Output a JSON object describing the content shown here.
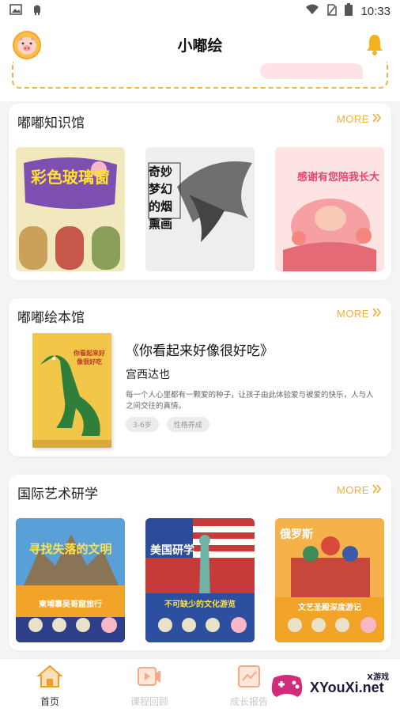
{
  "status_bar": {
    "time": "10:33",
    "icons": [
      "image-icon",
      "android-icon",
      "wifi-icon",
      "no-sim-icon",
      "battery-icon"
    ]
  },
  "header": {
    "title": "小嘟绘",
    "avatar": "pig-avatar-icon",
    "right_icon": "bell-icon"
  },
  "sections": {
    "knowledge": {
      "title": "嘟嘟知识馆",
      "more": "MORE",
      "items": [
        {
          "cover_text": "彩色玻璃窗",
          "accent": "#6a3fa0"
        },
        {
          "cover_text": "奇妙梦幻的烟熏画",
          "accent": "#333333"
        },
        {
          "cover_text": "感谢有您陪我长大",
          "accent": "#d9436b"
        }
      ]
    },
    "picturebook": {
      "title": "嘟嘟绘本馆",
      "more": "MORE",
      "book": {
        "title": "《你看起来好像很好吃》",
        "author": "宫西达也",
        "description": "每一个人心里都有一颗爱的种子，让孩子由此体验爱与被爱的快乐，人与人之间交往的真情。",
        "tags": [
          "3-6岁",
          "性格养成"
        ],
        "cover_text": "你看起来好像很好吃"
      }
    },
    "art": {
      "title": "国际艺术研学",
      "more": "MORE",
      "items": [
        {
          "cover_text": "寻找失落的文明",
          "caption": "柬埔寨吴哥窟旅行"
        },
        {
          "cover_text": "美国研学",
          "caption": "不可缺少的文化游览"
        },
        {
          "cover_text": "俄罗斯",
          "caption": "文艺圣殿深度游记"
        }
      ]
    }
  },
  "bottom_nav": [
    {
      "label": "首页",
      "icon": "home-icon",
      "active": true
    },
    {
      "label": "课程回顾",
      "icon": "video-icon",
      "active": false
    },
    {
      "label": "成长报告",
      "icon": "chart-icon",
      "active": false
    }
  ],
  "watermark": {
    "brand": "XYouXi.net",
    "small": "X游戏"
  },
  "colors": {
    "accent": "#f4b03d",
    "brand_orange": "#f6a623"
  }
}
